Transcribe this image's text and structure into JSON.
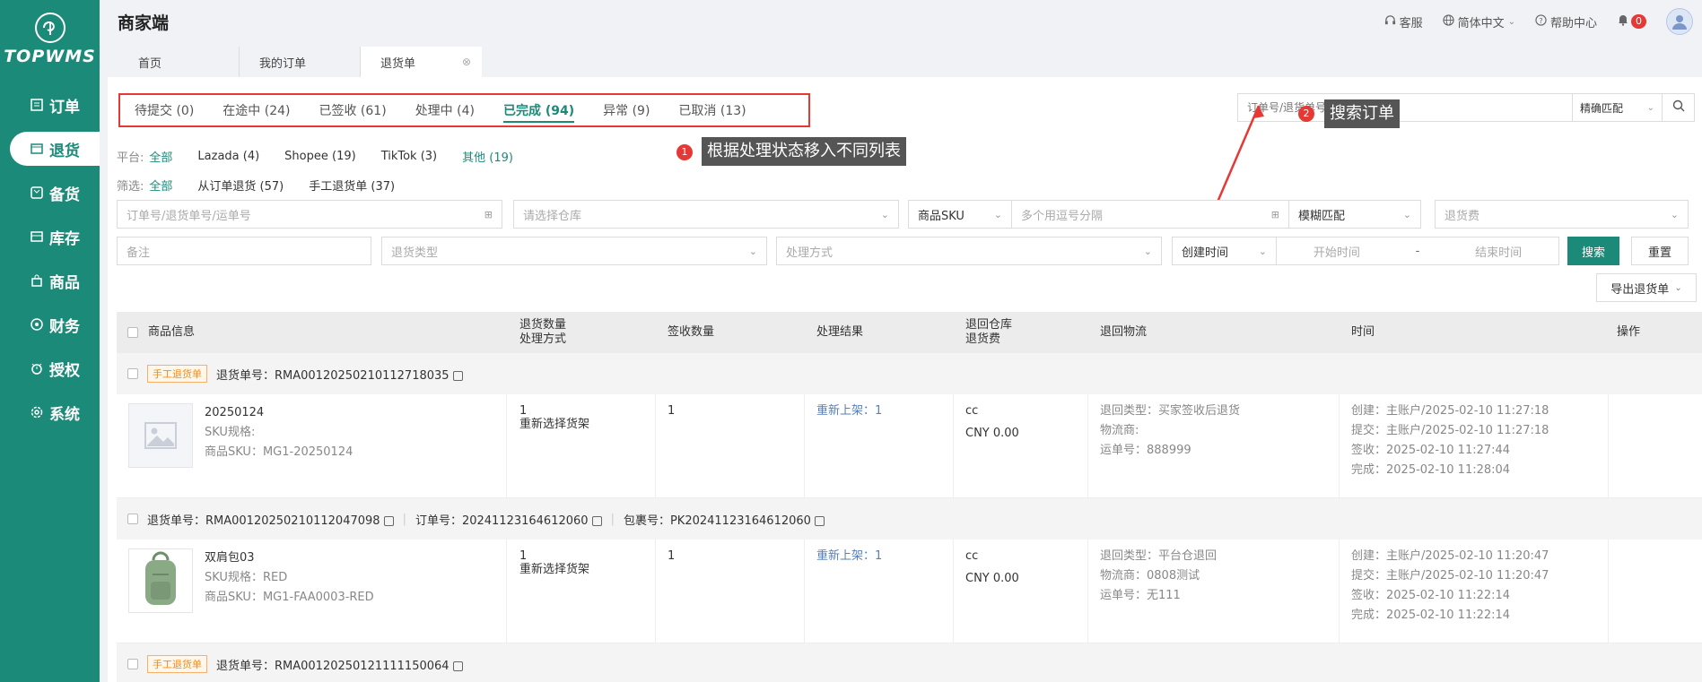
{
  "app": {
    "logo_text": "TOPWMS",
    "title": "商家端"
  },
  "sidebar": {
    "items": [
      {
        "label": "订单",
        "icon": "list-icon",
        "active": false
      },
      {
        "label": "退货",
        "icon": "return-icon",
        "active": true
      },
      {
        "label": "备货",
        "icon": "box-icon",
        "active": false
      },
      {
        "label": "库存",
        "icon": "warehouse-icon",
        "active": false
      },
      {
        "label": "商品",
        "icon": "bag-icon",
        "active": false
      },
      {
        "label": "财务",
        "icon": "finance-icon",
        "active": false
      },
      {
        "label": "授权",
        "icon": "auth-icon",
        "active": false
      },
      {
        "label": "系统",
        "icon": "gear-icon",
        "active": false
      }
    ]
  },
  "header": {
    "service": "客服",
    "language": "简体中文",
    "help": "帮助中心",
    "notifications": "0"
  },
  "tabs": [
    {
      "label": "首页"
    },
    {
      "label": "我的订单"
    },
    {
      "label": "退货单"
    }
  ],
  "status_tabs": [
    {
      "label": "待提交 (0)"
    },
    {
      "label": "在途中 (24)"
    },
    {
      "label": "已签收 (61)"
    },
    {
      "label": "处理中 (4)"
    },
    {
      "label": "已完成 (94)"
    },
    {
      "label": "异常 (9)"
    },
    {
      "label": "已取消 (13)"
    }
  ],
  "callouts": {
    "c1_num": "1",
    "c1_text": "根据处理状态移入不同列表",
    "c2_num": "2",
    "c2_text": "搜索订单"
  },
  "search": {
    "placeholder": "订单号/退货单号/运单号",
    "match": "精确匹配"
  },
  "platform_filter": {
    "label": "平台:",
    "options": [
      "全部",
      "Lazada (4)",
      "Shopee (19)",
      "TikTok (3)",
      "其他 (19)"
    ]
  },
  "type_filter": {
    "label": "筛选:",
    "options": [
      "全部",
      "从订单退货 (57)",
      "手工退货单 (37)"
    ]
  },
  "filters": {
    "order_no_placeholder": "订单号/退货单号/运单号",
    "warehouse_placeholder": "请选择仓库",
    "sku_type": "商品SKU",
    "sku_placeholder": "多个用逗号分隔",
    "fuzzy": "模糊匹配",
    "fee_placeholder": "退货费",
    "remark_placeholder": "备注",
    "return_type_placeholder": "退货类型",
    "process_placeholder": "处理方式",
    "time_type": "创建时间",
    "start_time": "开始时间",
    "dash": "-",
    "end_time": "结束时间",
    "search_btn": "搜索",
    "reset_btn": "重置",
    "export_btn": "导出退货单"
  },
  "table": {
    "headers": {
      "product": "商品信息",
      "qty1": "退货数量",
      "qty2": "处理方式",
      "signed": "签收数量",
      "result": "处理结果",
      "wh1": "退回仓库",
      "wh2": "退货费",
      "logistics": "退回物流",
      "time": "时间",
      "ops": "操作"
    },
    "groups": [
      {
        "tag": "手工退货单",
        "return_no": "退货单号：RMA00120250210112718035",
        "order_no": "",
        "package_no": "",
        "row": {
          "name": "20250124",
          "spec": "SKU规格:",
          "sku": "商品SKU：MG1-20250124",
          "qty": "1",
          "method": "重新选择货架",
          "signed": "1",
          "result": "重新上架：1",
          "warehouse": "cc",
          "fee": "CNY 0.00",
          "ret_type": "退回类型：买家签收后退货",
          "carrier": "物流商:",
          "tracking": "运单号：888999",
          "t_create": "创建：主账户/2025-02-10 11:27:18",
          "t_submit": "提交：主账户/2025-02-10 11:27:18",
          "t_sign": "签收：2025-02-10 11:27:44",
          "t_done": "完成：2025-02-10 11:28:04"
        }
      },
      {
        "tag": "",
        "return_no": "退货单号：RMA00120250210112047098",
        "order_no": "订单号：20241123164612060",
        "package_no": "包裹号：PK20241123164612060",
        "row": {
          "name": "双肩包03",
          "spec": "SKU规格：RED",
          "sku": "商品SKU：MG1-FAA0003-RED",
          "qty": "1",
          "method": "重新选择货架",
          "signed": "1",
          "result": "重新上架：1",
          "warehouse": "cc",
          "fee": "CNY 0.00",
          "ret_type": "退回类型：平台仓退回",
          "carrier": "物流商：0808测试",
          "tracking": "运单号：无111",
          "t_create": "创建：主账户/2025-02-10 11:20:47",
          "t_submit": "提交：主账户/2025-02-10 11:20:47",
          "t_sign": "签收：2025-02-10 11:22:14",
          "t_done": "完成：2025-02-10 11:22:14"
        }
      },
      {
        "tag": "手工退货单",
        "return_no": "退货单号：RMA00120250121111150064"
      }
    ]
  },
  "colors": {
    "brand": "#1c8a78",
    "alert": "#e53935",
    "tag": "#f08c1a"
  }
}
